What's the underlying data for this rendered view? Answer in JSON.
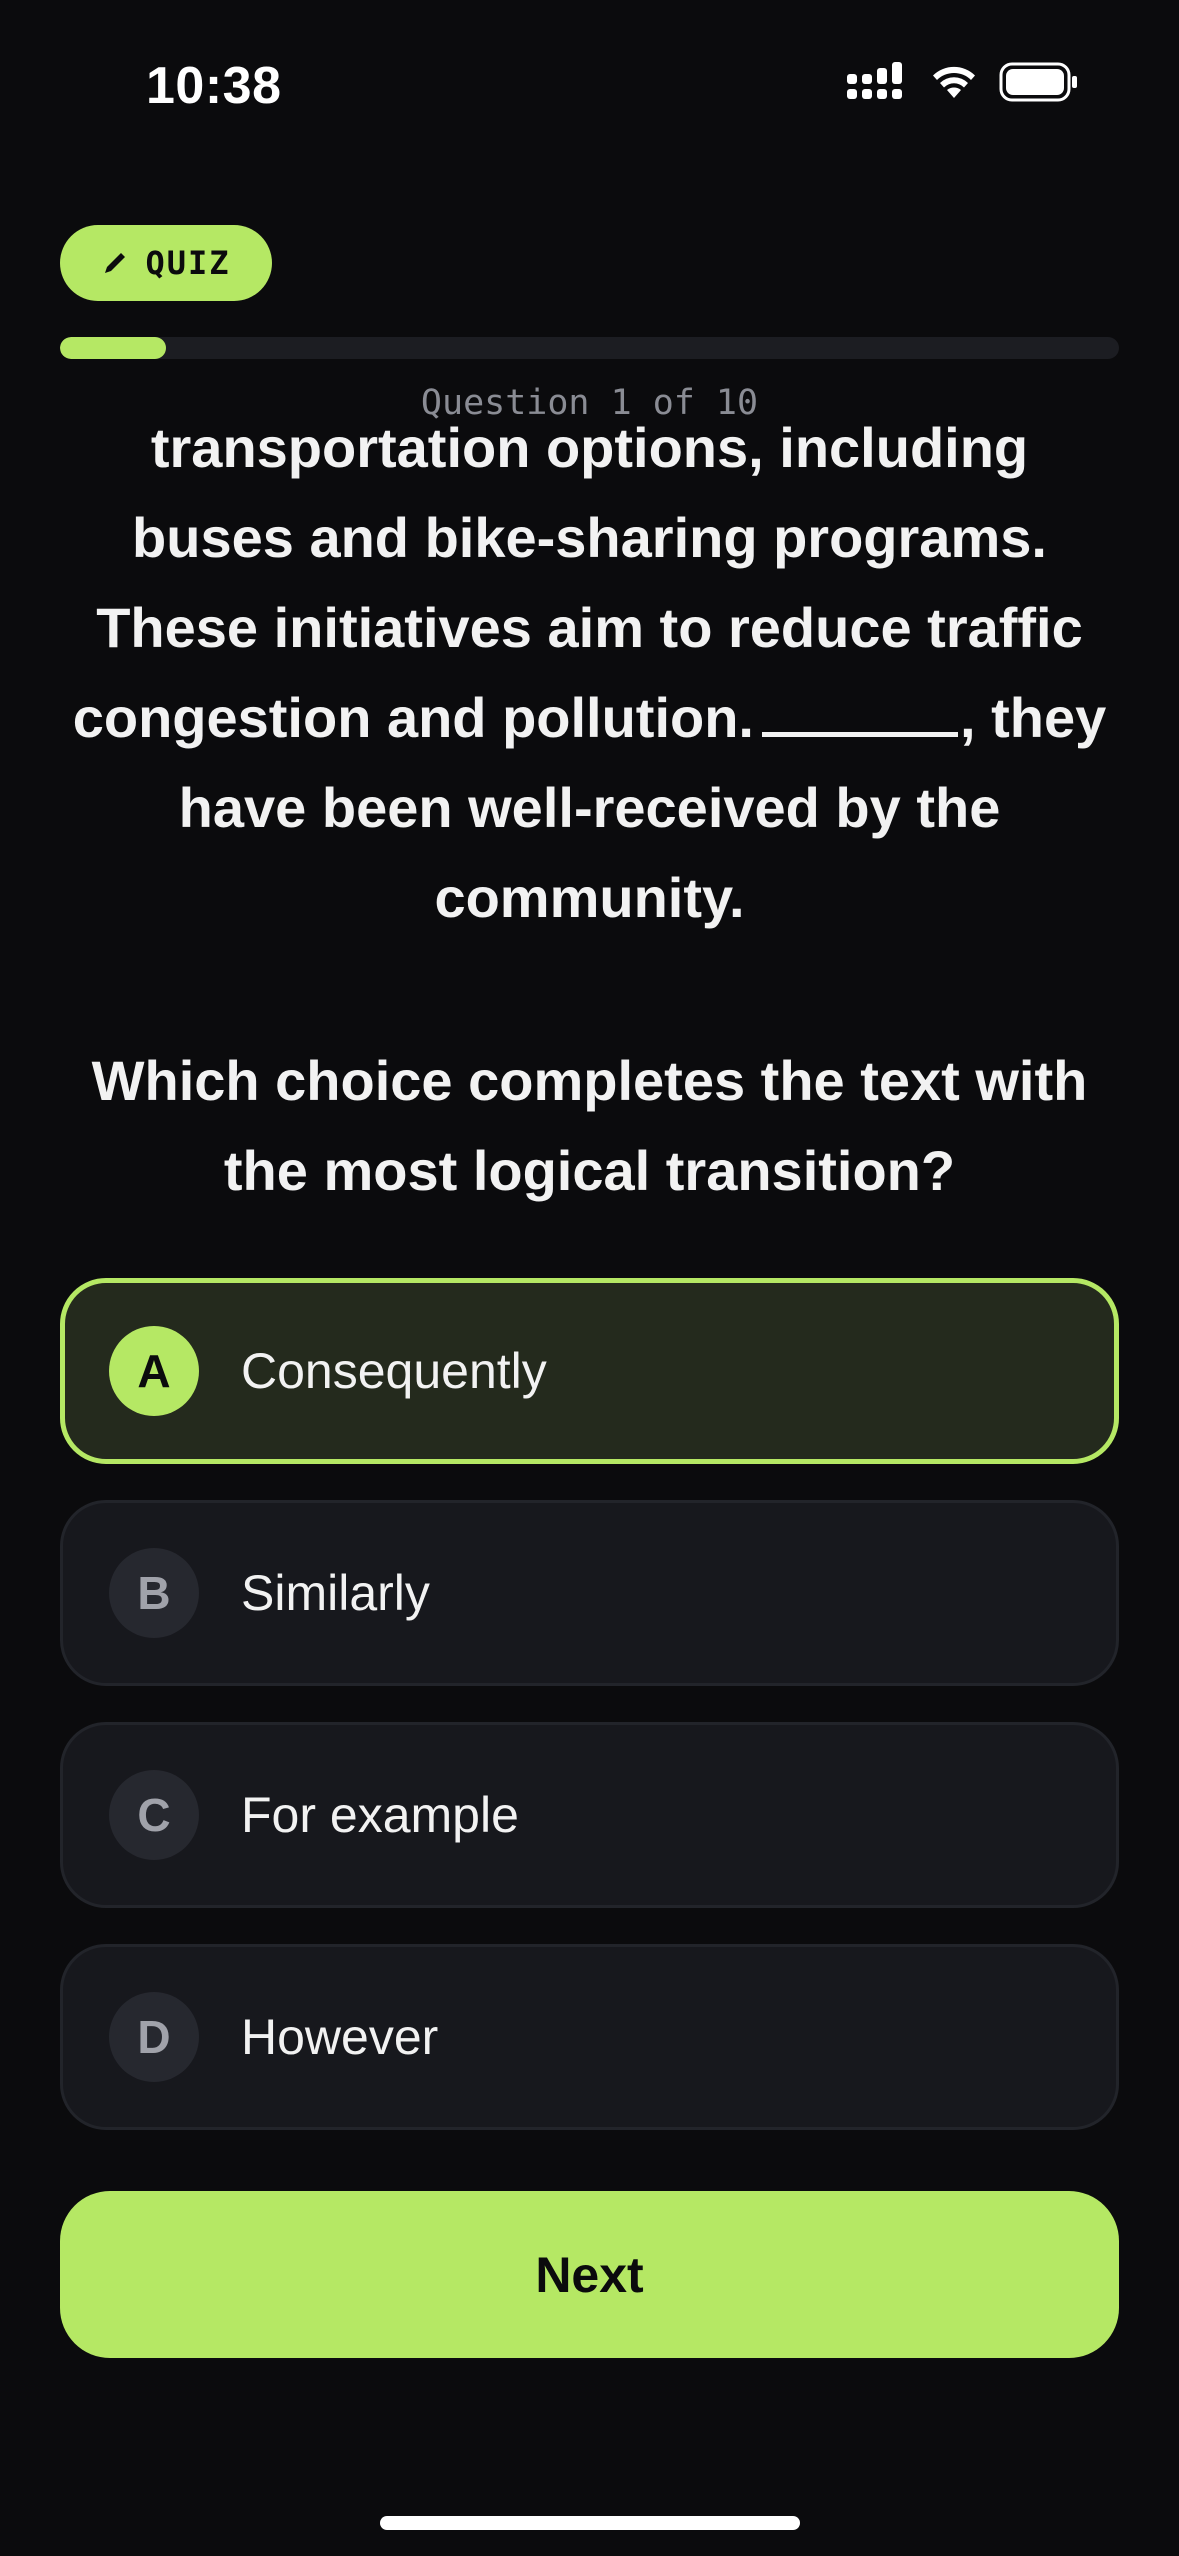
{
  "status_bar": {
    "time": "10:38",
    "icons": [
      "cellular-signal-icon",
      "wifi-icon",
      "battery-icon"
    ]
  },
  "quiz": {
    "badge_label": "QUIZ",
    "badge_icon": "pencil-icon",
    "progress_label": "Question 1 of 10",
    "progress_fraction": 0.1
  },
  "passage": {
    "text_before_blank": "transportation options, including buses and bike-sharing programs. These initiatives aim to reduce traffic congestion and pollution.",
    "text_after_blank": ", they have been well-received by the community."
  },
  "prompt": "Which choice completes the text with the most logical transition?",
  "options": [
    {
      "letter": "A",
      "text": "Consequently",
      "selected": true
    },
    {
      "letter": "B",
      "text": "Similarly",
      "selected": false
    },
    {
      "letter": "C",
      "text": "For example",
      "selected": false
    },
    {
      "letter": "D",
      "text": "However",
      "selected": false
    }
  ],
  "next_label": "Next",
  "colors": {
    "accent": "#b5e864",
    "background": "#0b0b0d",
    "card": "#17181d",
    "selected_card": "#242a1d"
  }
}
